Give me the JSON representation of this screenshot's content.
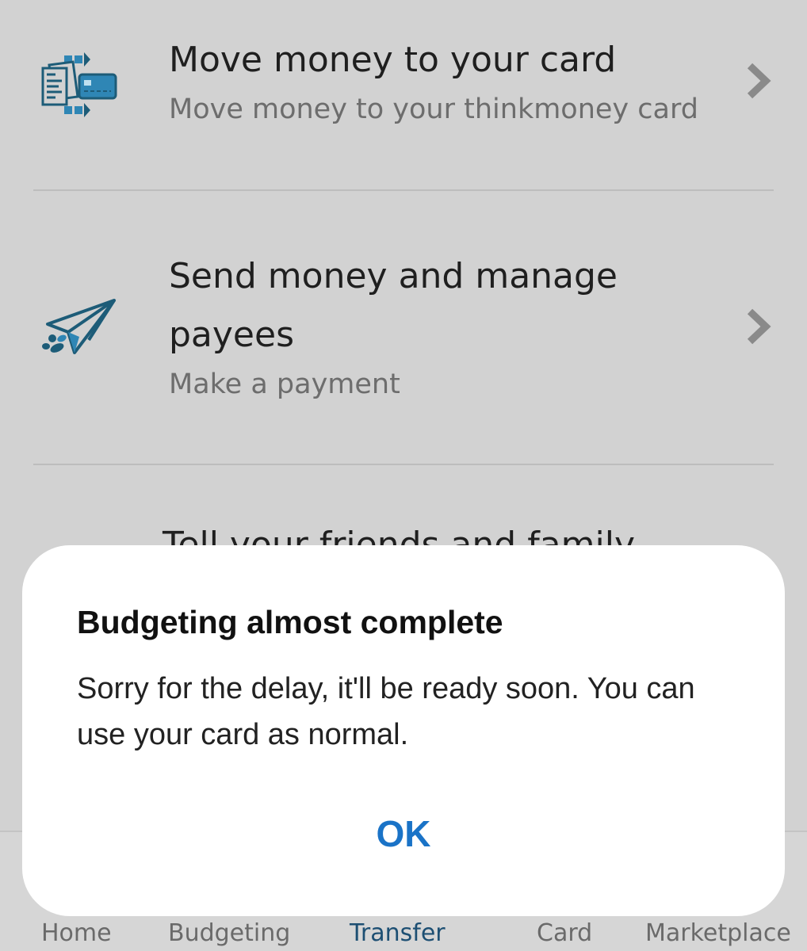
{
  "menu": {
    "items": [
      {
        "title": "Move money to your card",
        "subtitle": "Move money to your thinkmoney card",
        "icon": "card-transfer-icon"
      },
      {
        "title_line1": "Send money and manage",
        "title_line2": "payees",
        "subtitle": "Make a payment",
        "icon": "paper-plane-icon"
      },
      {
        "title_partial": "Tell your friends and family"
      }
    ]
  },
  "bottom_nav": {
    "items": [
      {
        "label": "Home"
      },
      {
        "label": "Budgeting"
      },
      {
        "label": "Transfer",
        "active": true
      },
      {
        "label": "Card"
      },
      {
        "label": "Marketplace"
      }
    ]
  },
  "dialog": {
    "title": "Budgeting almost complete",
    "message": "Sorry for the delay, it'll be ready soon. You can use your card as normal.",
    "ok_label": "OK"
  },
  "colors": {
    "background": "#d2d2d2",
    "icon_teal": "#1d5c78",
    "icon_blue": "#2f86b5",
    "ok_blue": "#1a73c7",
    "nav_active": "#1d4f73",
    "dialog_bg": "#ffffff"
  }
}
